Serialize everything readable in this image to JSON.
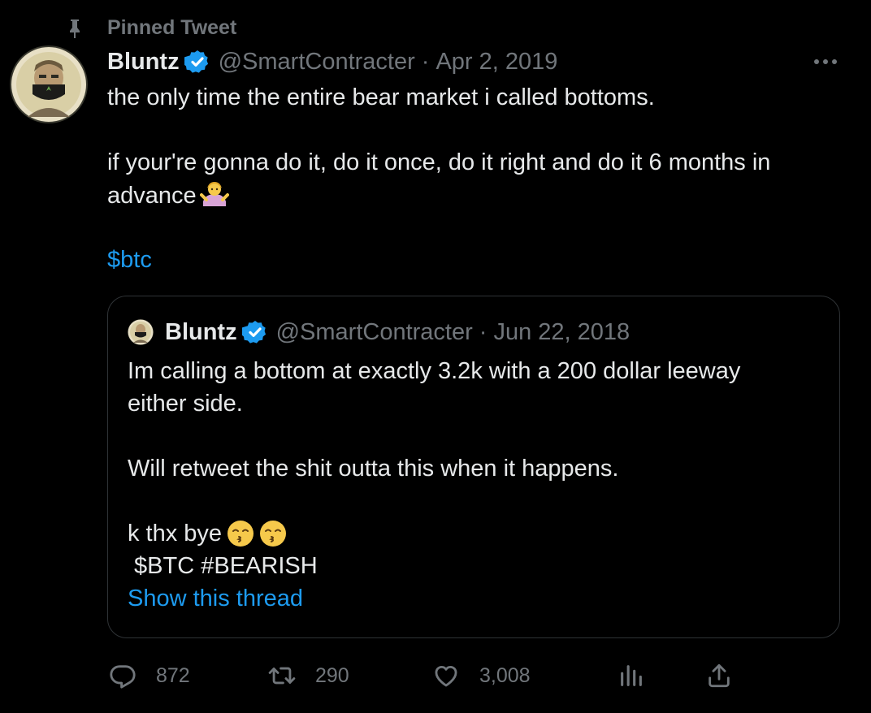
{
  "pinned": {
    "label": "Pinned Tweet"
  },
  "tweet": {
    "author_name": "Bluntz",
    "handle": "@SmartContracter",
    "separator": "·",
    "date": "Apr 2, 2019",
    "lines": [
      "the only time the entire bear market i called bottoms.",
      "if your're gonna do it, do it once, do it right and do it 6 months in",
      "advance"
    ],
    "cashtag": "$btc"
  },
  "quote": {
    "author_name": "Bluntz",
    "handle": "@SmartContracter",
    "separator": "·",
    "date": "Jun 22, 2018",
    "lines": [
      "Im calling a bottom at exactly 3.2k with a 200 dollar leeway",
      "either side.",
      "Will retweet the shit outta this when it happens.",
      "k thx bye",
      " $BTC #BEARISH"
    ],
    "show_thread": "Show this thread"
  },
  "actions": {
    "replies": "872",
    "retweets": "290",
    "likes": "3,008"
  },
  "icons": {
    "pin": "pin-icon",
    "verified": "verified-badge-icon",
    "more": "more-options-icon",
    "reply": "reply-icon",
    "retweet": "retweet-icon",
    "like": "heart-icon",
    "views": "views-chart-icon",
    "share": "share-icon",
    "shrug": "person-shrugging-emoji",
    "kiss": "kissing-face-emoji"
  },
  "colors": {
    "background": "#000000",
    "text": "#e7e9ea",
    "muted": "#71767b",
    "link": "#1d9bf0",
    "border": "#2f3336"
  }
}
